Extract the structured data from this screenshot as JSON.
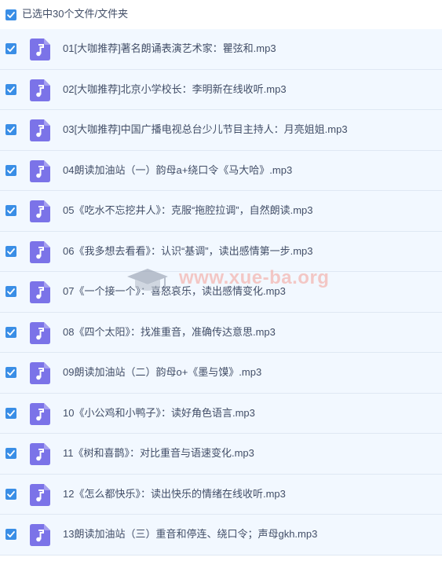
{
  "header": {
    "selected_text": "已选中30个文件/文件夹"
  },
  "files": [
    {
      "name": "01[大咖推荐]著名朗诵表演艺术家：瞿弦和.mp3"
    },
    {
      "name": "02[大咖推荐]北京小学校长：李明新在线收听.mp3"
    },
    {
      "name": "03[大咖推荐]中国广播电视总台少儿节目主持人：月亮姐姐.mp3"
    },
    {
      "name": "04朗读加油站（一）韵母a+绕口令《马大哈》.mp3"
    },
    {
      "name": "05《吃水不忘挖井人》：克服“拖腔拉调”，自然朗读.mp3"
    },
    {
      "name": "06《我多想去看看》：认识“基调”，读出感情第一步.mp3"
    },
    {
      "name": "07《一个接一个》：喜怒哀乐，读出感情变化.mp3"
    },
    {
      "name": "08《四个太阳》：找准重音，准确传达意思.mp3"
    },
    {
      "name": "09朗读加油站（二）韵母o+《墨与馍》.mp3"
    },
    {
      "name": "10《小公鸡和小鸭子》：读好角色语言.mp3"
    },
    {
      "name": "11《树和喜鹊》：对比重音与语速变化.mp3"
    },
    {
      "name": "12《怎么都快乐》：读出快乐的情绪在线收听.mp3"
    },
    {
      "name": "13朗读加油站（三）重音和停连、绕口令；声母gkh.mp3"
    }
  ],
  "watermark": {
    "text": "www.xue-ba.org"
  },
  "colors": {
    "checkbox": "#3a8ee6",
    "file_icon": "#7b73e8",
    "row_bg": "#f2f8ff",
    "text": "#424e67"
  },
  "icons": {
    "checkbox": "checkmark-icon",
    "file": "music-note-icon"
  }
}
